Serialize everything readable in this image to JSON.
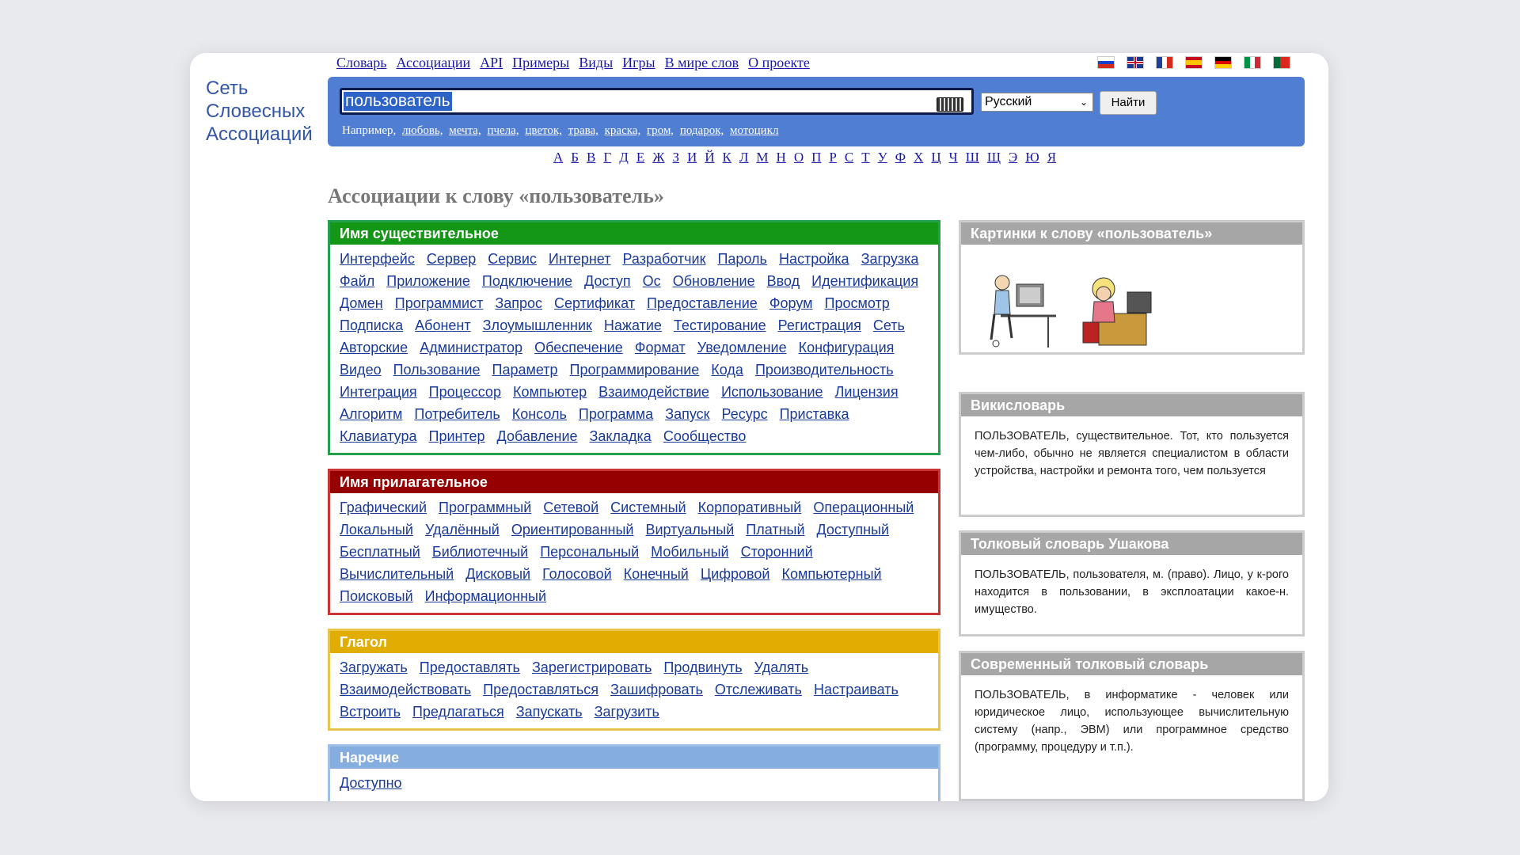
{
  "logo": {
    "line1": "Сеть",
    "line2": "Словесных",
    "line3": "Ассоциаций"
  },
  "nav": [
    "Словарь",
    "Ассоциации",
    "API",
    "Примеры",
    "Виды",
    "Игры",
    "В мире слов",
    "О проекте"
  ],
  "flags": [
    "ru",
    "en",
    "fr",
    "es",
    "de",
    "it",
    "pt"
  ],
  "search": {
    "value": "пользователь",
    "language": "Русский",
    "button": "Найти",
    "examples_label": "Например,",
    "examples": [
      "любовь,",
      "мечта,",
      "пчела,",
      "цветок,",
      "трава,",
      "краска,",
      "гром,",
      "подарок,",
      "мотоцикл"
    ]
  },
  "alphabet": [
    "А",
    "Б",
    "В",
    "Г",
    "Д",
    "Е",
    "Ж",
    "З",
    "И",
    "Й",
    "К",
    "Л",
    "М",
    "Н",
    "О",
    "П",
    "Р",
    "С",
    "Т",
    "У",
    "Ф",
    "Х",
    "Ц",
    "Ч",
    "Ш",
    "Щ",
    "Э",
    "Ю",
    "Я"
  ],
  "title": "Ассоциации к слову «пользователь»",
  "noun": {
    "heading": "Имя существительное",
    "words": [
      "Интерфейс",
      "Сервер",
      "Сервис",
      "Интернет",
      "Разработчик",
      "Пароль",
      "Настройка",
      "Загрузка",
      "Файл",
      "Приложение",
      "Подключение",
      "Доступ",
      "Ос",
      "Обновление",
      "Ввод",
      "Идентификация",
      "Домен",
      "Программист",
      "Запрос",
      "Сертификат",
      "Предоставление",
      "Форум",
      "Просмотр",
      "Подписка",
      "Абонент",
      "Злоумышленник",
      "Нажатие",
      "Тестирование",
      "Регистрация",
      "Сеть",
      "Авторские",
      "Администратор",
      "Обеспечение",
      "Формат",
      "Уведомление",
      "Конфигурация",
      "Видео",
      "Пользование",
      "Параметр",
      "Программирование",
      "Кода",
      "Производительность",
      "Интеграция",
      "Процессор",
      "Компьютер",
      "Взаимодействие",
      "Использование",
      "Лицензия",
      "Алгоритм",
      "Потребитель",
      "Консоль",
      "Программа",
      "Запуск",
      "Ресурс",
      "Приставка",
      "Клавиатура",
      "Принтер",
      "Добавление",
      "Закладка",
      "Сообщество"
    ]
  },
  "adj": {
    "heading": "Имя прилагательное",
    "words": [
      "Графический",
      "Программный",
      "Сетевой",
      "Системный",
      "Корпоративный",
      "Операционный",
      "Локальный",
      "Удалённый",
      "Ориентированный",
      "Виртуальный",
      "Платный",
      "Доступный",
      "Бесплатный",
      "Библиотечный",
      "Персональный",
      "Мобильный",
      "Сторонний",
      "Вычислительный",
      "Дисковый",
      "Голосовой",
      "Конечный",
      "Цифровой",
      "Компьютерный",
      "Поисковый",
      "Информационный"
    ]
  },
  "verb": {
    "heading": "Глагол",
    "words": [
      "Загружать",
      "Предоставлять",
      "Зарегистрировать",
      "Продвинуть",
      "Удалять",
      "Взаимодействовать",
      "Предоставляться",
      "Зашифровать",
      "Отслеживать",
      "Настраивать",
      "Встроить",
      "Предлагаться",
      "Запускать",
      "Загрузить"
    ]
  },
  "adv": {
    "heading": "Наречие",
    "words": [
      "Доступно"
    ]
  },
  "side": {
    "pictures_heading": "Картинки к слову «пользователь»",
    "wiki_heading": "Викисловарь",
    "wiki_text": "ПОЛЬЗОВАТЕЛЬ, существительное. Тот, кто пользуется чем-либо, обычно не является специалистом в области устройства, настройки и ремонта того, чем пользуется",
    "ushakov_heading": "Толковый словарь Ушакова",
    "ushakov_text": "ПОЛЬЗОВАТЕЛЬ, пользователя, м. (право). Лицо, у к-рого находится в пользовании, в эксплоатации какое-н. имущество.",
    "modern_heading": "Современный толковый словарь",
    "modern_text": "ПОЛЬЗОВАТЕЛЬ, в информатике - человек или юридическое лицо, использующее вычислительную систему (напр., ЭВМ) или программное средство (программу, процедуру и т.п.)."
  }
}
